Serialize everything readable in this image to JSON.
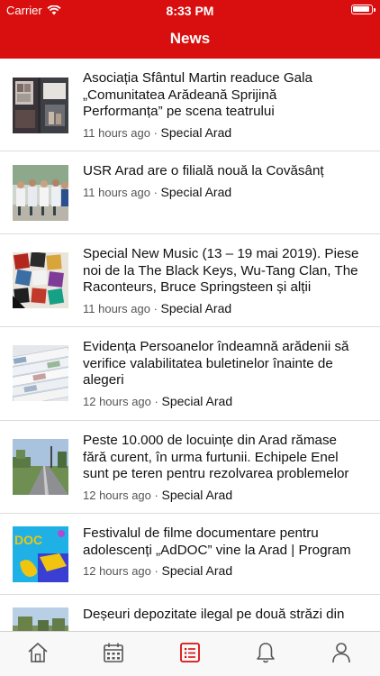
{
  "status_bar": {
    "carrier": "Carrier",
    "time": "8:33 PM"
  },
  "header": {
    "title": "News"
  },
  "colors": {
    "accent": "#d90f0f",
    "tab_inactive": "#555555"
  },
  "articles": [
    {
      "title_lines": [
        "Asociația Sfântul Martin readuce Gala",
        "„Comunitatea Arădeană Sprijină",
        "Performanța” pe scena teatrului"
      ],
      "time": "11 hours ago",
      "separator": "·",
      "source": "Special Arad"
    },
    {
      "title_lines": [
        "USR Arad are o filială nouă la Covăsânț"
      ],
      "time": "11 hours ago",
      "separator": "·",
      "source": "Special Arad"
    },
    {
      "title_lines": [
        "Special New Music (13 – 19 mai 2019). Piese",
        "noi de la The Black Keys, Wu-Tang Clan, The",
        "Raconteurs, Bruce Springsteen și alții"
      ],
      "time": "11 hours ago",
      "separator": "·",
      "source": "Special Arad"
    },
    {
      "title_lines": [
        "Evidența Persoanelor îndeamnă arădenii să",
        "verifice valabilitatea buletinelor înainte de",
        "alegeri"
      ],
      "time": "12 hours ago",
      "separator": "·",
      "source": "Special Arad"
    },
    {
      "title_lines": [
        "Peste 10.000 de locuințe din Arad rămase",
        "fără curent, în urma furtunii. Echipele Enel",
        "sunt pe teren pentru rezolvarea problemelor"
      ],
      "time": "12 hours ago",
      "separator": "·",
      "source": "Special Arad"
    },
    {
      "title_lines": [
        "Festivalul de filme documentare pentru",
        "adolescenți „AdDOC” vine la Arad | Program"
      ],
      "time": "12 hours ago",
      "separator": "·",
      "source": "Special Arad",
      "thumb_text": "DOC"
    },
    {
      "title_lines": [
        "Deșeuri depozitate ilegal pe două străzi din"
      ],
      "time": "",
      "separator": "",
      "source": ""
    }
  ],
  "tabbar": {
    "tabs": [
      {
        "icon": "home-icon",
        "active": false
      },
      {
        "icon": "calendar-icon",
        "active": false
      },
      {
        "icon": "news-list-icon",
        "active": true
      },
      {
        "icon": "bell-icon",
        "active": false
      },
      {
        "icon": "profile-icon",
        "active": false
      }
    ]
  }
}
